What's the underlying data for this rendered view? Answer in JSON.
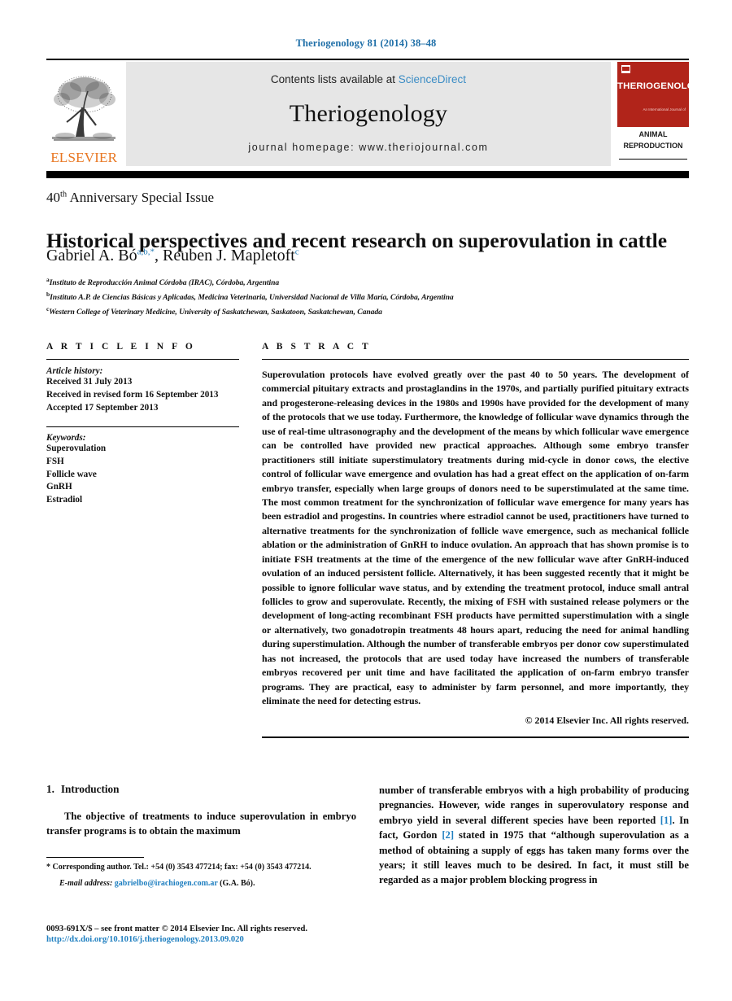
{
  "running_head": "Theriogenology 81 (2014) 38–48",
  "masthead": {
    "contents_prefix": "Contents lists available at",
    "sciencedirect": "ScienceDirect",
    "journal_name": "Theriogenology",
    "homepage": "journal homepage: www.theriojournal.com",
    "publisher_wordmark": "ELSEVIER",
    "cover": {
      "title": "THERIOGENOLOGY",
      "subtitle_small": "An International Journal of",
      "line1": "ANIMAL",
      "line2": "REPRODUCTION"
    }
  },
  "header": {
    "special_issue_pre": "40",
    "special_issue_sup": "th",
    "special_issue_post": " Anniversary Special Issue",
    "title": "Historical perspectives and recent research on superovulation in cattle"
  },
  "authors": {
    "author1_name": "Gabriel A. Bó",
    "author1_sup": "a,b,",
    "author1_star": "*",
    "separator": ", ",
    "author2_name": "Reuben J. Mapletoft",
    "author2_sup": "c",
    "affiliations": [
      {
        "marker": "a",
        "text": "Instituto de Reproducción Animal Córdoba (IRAC), Córdoba, Argentina"
      },
      {
        "marker": "b",
        "text": "Instituto A.P. de Ciencias Básicas y Aplicadas, Medicina Veterinaria, Universidad Nacional de Villa María, Córdoba, Argentina"
      },
      {
        "marker": "c",
        "text": "Western College of Veterinary Medicine, University of Saskatchewan, Saskatoon, Saskatchewan, Canada"
      }
    ]
  },
  "article_info": {
    "label": "A R T I C L E   I N F O",
    "history_label": "Article history:",
    "history": [
      "Received 31 July 2013",
      "Received in revised form 16 September 2013",
      "Accepted 17 September 2013"
    ],
    "keywords_label": "Keywords:",
    "keywords": [
      "Superovulation",
      "FSH",
      "Follicle wave",
      "GnRH",
      "Estradiol"
    ]
  },
  "abstract": {
    "label": "A B S T R A C T",
    "text": "Superovulation protocols have evolved greatly over the past 40 to 50 years. The development of commercial pituitary extracts and prostaglandins in the 1970s, and partially purified pituitary extracts and progesterone-releasing devices in the 1980s and 1990s have provided for the development of many of the protocols that we use today. Furthermore, the knowledge of follicular wave dynamics through the use of real-time ultrasonography and the development of the means by which follicular wave emergence can be controlled have provided new practical approaches. Although some embryo transfer practitioners still initiate superstimulatory treatments during mid-cycle in donor cows, the elective control of follicular wave emergence and ovulation has had a great effect on the application of on-farm embryo transfer, especially when large groups of donors need to be superstimulated at the same time. The most common treatment for the synchronization of follicular wave emergence for many years has been estradiol and progestins. In countries where estradiol cannot be used, practitioners have turned to alternative treatments for the synchronization of follicle wave emergence, such as mechanical follicle ablation or the administration of GnRH to induce ovulation. An approach that has shown promise is to initiate FSH treatments at the time of the emergence of the new follicular wave after GnRH-induced ovulation of an induced persistent follicle. Alternatively, it has been suggested recently that it might be possible to ignore follicular wave status, and by extending the treatment protocol, induce small antral follicles to grow and superovulate. Recently, the mixing of FSH with sustained release polymers or the development of long-acting recombinant FSH products have permitted superstimulation with a single or alternatively, two gonadotropin treatments 48 hours apart, reducing the need for animal handling during superstimulation. Although the number of transferable embryos per donor cow superstimulated has not increased, the protocols that are used today have increased the numbers of transferable embryos recovered per unit time and have facilitated the application of on-farm embryo transfer programs. They are practical, easy to administer by farm personnel, and more importantly, they eliminate the need for detecting estrus.",
    "copyright": "© 2014 Elsevier Inc. All rights reserved."
  },
  "introduction": {
    "number": "1.",
    "heading": "Introduction",
    "left_paragraph": "The objective of treatments to induce superovulation in embryo transfer programs is to obtain the maximum",
    "right_part1": "number of transferable embryos with a high probability of producing pregnancies. However, wide ranges in superovulatory response and embryo yield in several different species have been reported ",
    "ref1": "[1]",
    "right_part2": ". In fact, Gordon ",
    "ref2": "[2]",
    "right_part3": " stated in 1975 that “although superovulation as a method of obtaining a supply of eggs has taken many forms over the years; it still leaves much to be desired. In fact, it must still be regarded as a major problem blocking progress in"
  },
  "footnote": {
    "star": "*",
    "corresponding": "Corresponding author. Tel.: +54 (0) 3543 477214; fax: +54 (0) 3543 477214.",
    "email_label": "E-mail address:",
    "email": "gabrielbo@irachiogen.com.ar",
    "email_owner": "(G.A. Bó)."
  },
  "footer": {
    "issn_line": "0093-691X/$ – see front matter © 2014 Elsevier Inc. All rights reserved.",
    "doi": "http://dx.doi.org/10.1016/j.theriogenology.2013.09.020"
  },
  "colors": {
    "link_blue": "#1f7fc0",
    "header_blue": "#1f6fa8",
    "sciencedirect_blue": "#3c8dc5",
    "elsevier_orange": "#e87722",
    "cover_red": "#b1241a"
  }
}
